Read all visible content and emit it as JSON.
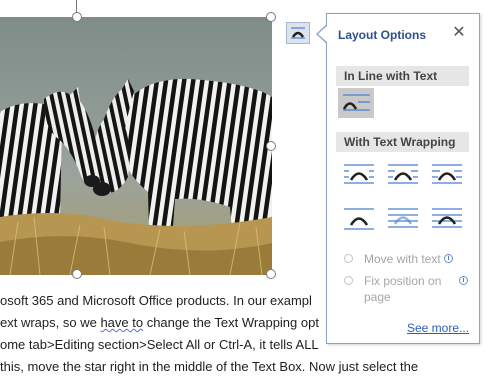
{
  "document": {
    "lines": [
      "osoft 365 and Microsoft Office products.  In our exampl",
      "ext wraps, so we ",
      "have to",
      " change the Text Wrapping opt",
      "ome tab>Editing section>Select All or Ctrl-A, it tells ALL",
      "this, move the star right in the middle of the Text Box.  Now just select the"
    ]
  },
  "layout_options": {
    "title": "Layout Options",
    "close_glyph": "✕",
    "inline_header": "In Line with Text",
    "wrapping_header": "With Text Wrapping",
    "move_with_text": "Move with text",
    "fix_position_line1": "Fix position on",
    "fix_position_line2": "page",
    "see_more": "See more...",
    "selected_option": "inline-with-text",
    "accent_color": "#2e4f8f",
    "icon_blue": "#4a7fd4"
  }
}
